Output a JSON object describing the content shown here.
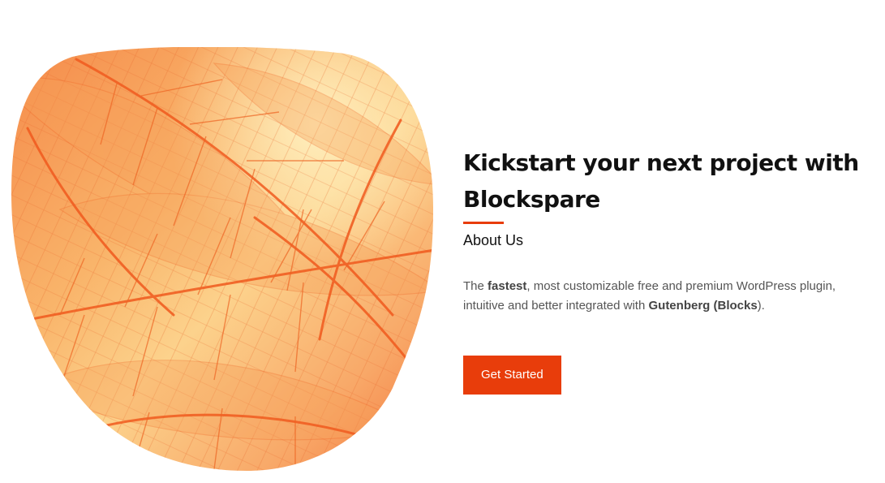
{
  "hero": {
    "title_line1": "Kickstart your next project with",
    "title_line2": "Blockspare",
    "subtitle": "About Us",
    "description": {
      "p1": "The ",
      "b1": "fastest",
      "p2": ", most customizable free and premium WordPress plugin, intuitive and better integrated with ",
      "b2": "Gutenberg (Blocks",
      "p3": ")."
    },
    "button_label": "Get Started"
  },
  "colors": {
    "accent": "#e83d0b",
    "heading": "#111111",
    "text": "#555555"
  }
}
